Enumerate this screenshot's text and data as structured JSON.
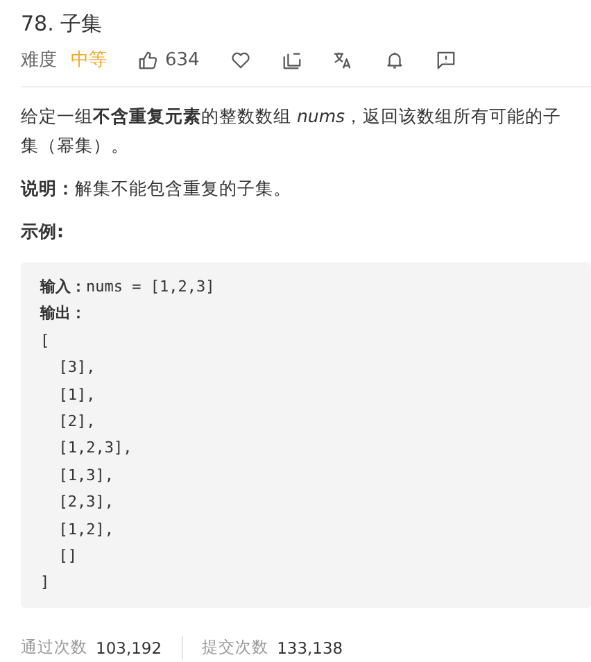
{
  "title": "78. 子集",
  "difficulty": {
    "label": "难度",
    "value": "中等"
  },
  "likes": "634",
  "description": "给定一组**不含重复元素**的整数数组 *nums*，返回该数组所有可能的子集（幂集）。",
  "note": "**说明：**解集不能包含重复的子集。",
  "example_heading": "示例:",
  "example_lines": [
    "**输入：**nums = [1,2,3]",
    "**输出：**",
    "[",
    "  [3],",
    "  [1],",
    "  [2],",
    "  [1,2,3],",
    "  [1,3],",
    "  [2,3],",
    "  [1,2],",
    "  []",
    "]"
  ],
  "stats": [
    {
      "label": "通过次数",
      "value": "103,192"
    },
    {
      "label": "提交次数",
      "value": "133,138"
    }
  ]
}
